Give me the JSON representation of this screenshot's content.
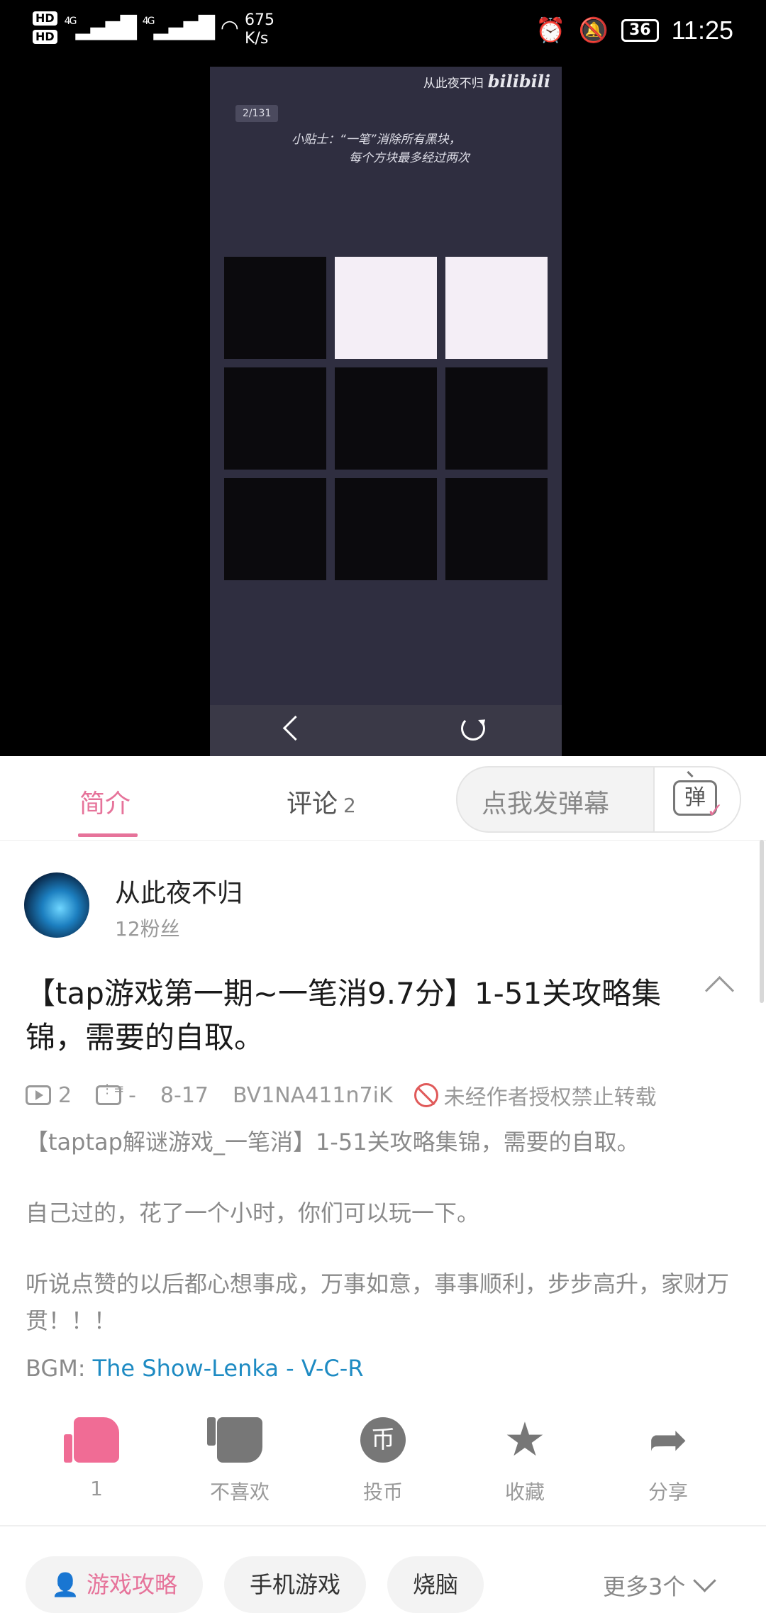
{
  "status_bar": {
    "network_speed": "675",
    "network_unit": "K/s",
    "battery": "36",
    "time": "11:25"
  },
  "game": {
    "author": "从此夜不归",
    "watermark": "bilibili",
    "level": "2/131",
    "tip_line1": "小贴士：“一笔”消除所有黑块，",
    "tip_line2": "每个方块最多经过两次"
  },
  "tabs": {
    "intro": "简介",
    "comments": "评论",
    "comments_count": "2",
    "danmaku_placeholder": "点我发弹幕",
    "danmaku_icon_char": "弹"
  },
  "uploader": {
    "name": "从此夜不归",
    "fans": "12粉丝"
  },
  "video": {
    "title": "【tap游戏第一期~一笔消9.7分】1-51关攻略集锦，需要的自取。",
    "plays": "2",
    "danmaku_count": "-",
    "date": "8-17",
    "bvid": "BV1NA411n7iK",
    "copyright": "未经作者授权禁止转载",
    "desc1": "【taptap解谜游戏_一笔消】1-51关攻略集锦，需要的自取。",
    "desc2": "自己过的，花了一个小时，你们可以玩一下。",
    "desc3": "听说点赞的以后都心想事成，万事如意，事事顺利，步步高升，家财万贯！！！",
    "bgm_label": "BGM:",
    "bgm_link": "The Show-Lenka - V-C-R"
  },
  "actions": {
    "like": "1",
    "dislike": "不喜欢",
    "coin": "投币",
    "favorite": "收藏",
    "share": "分享"
  },
  "tags": {
    "items": [
      "游戏攻略",
      "手机游戏",
      "烧脑"
    ],
    "more": "更多3个"
  },
  "colors": {
    "accent": "#e6739a",
    "link": "#1e8bc3"
  }
}
